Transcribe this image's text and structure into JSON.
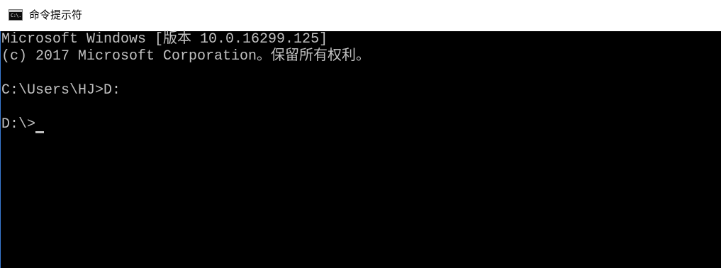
{
  "window": {
    "title": "命令提示符",
    "icon_glyph": "C:\\."
  },
  "console": {
    "lines": [
      "Microsoft Windows [版本 10.0.16299.125]",
      "(c) 2017 Microsoft Corporation。保留所有权利。",
      "",
      "C:\\Users\\HJ>D:",
      "",
      "D:\\>"
    ]
  },
  "colors": {
    "console_background": "#000000",
    "console_text": "#c0c0c0",
    "titlebar_background": "#ffffff",
    "window_border": "#3a7bd5"
  }
}
